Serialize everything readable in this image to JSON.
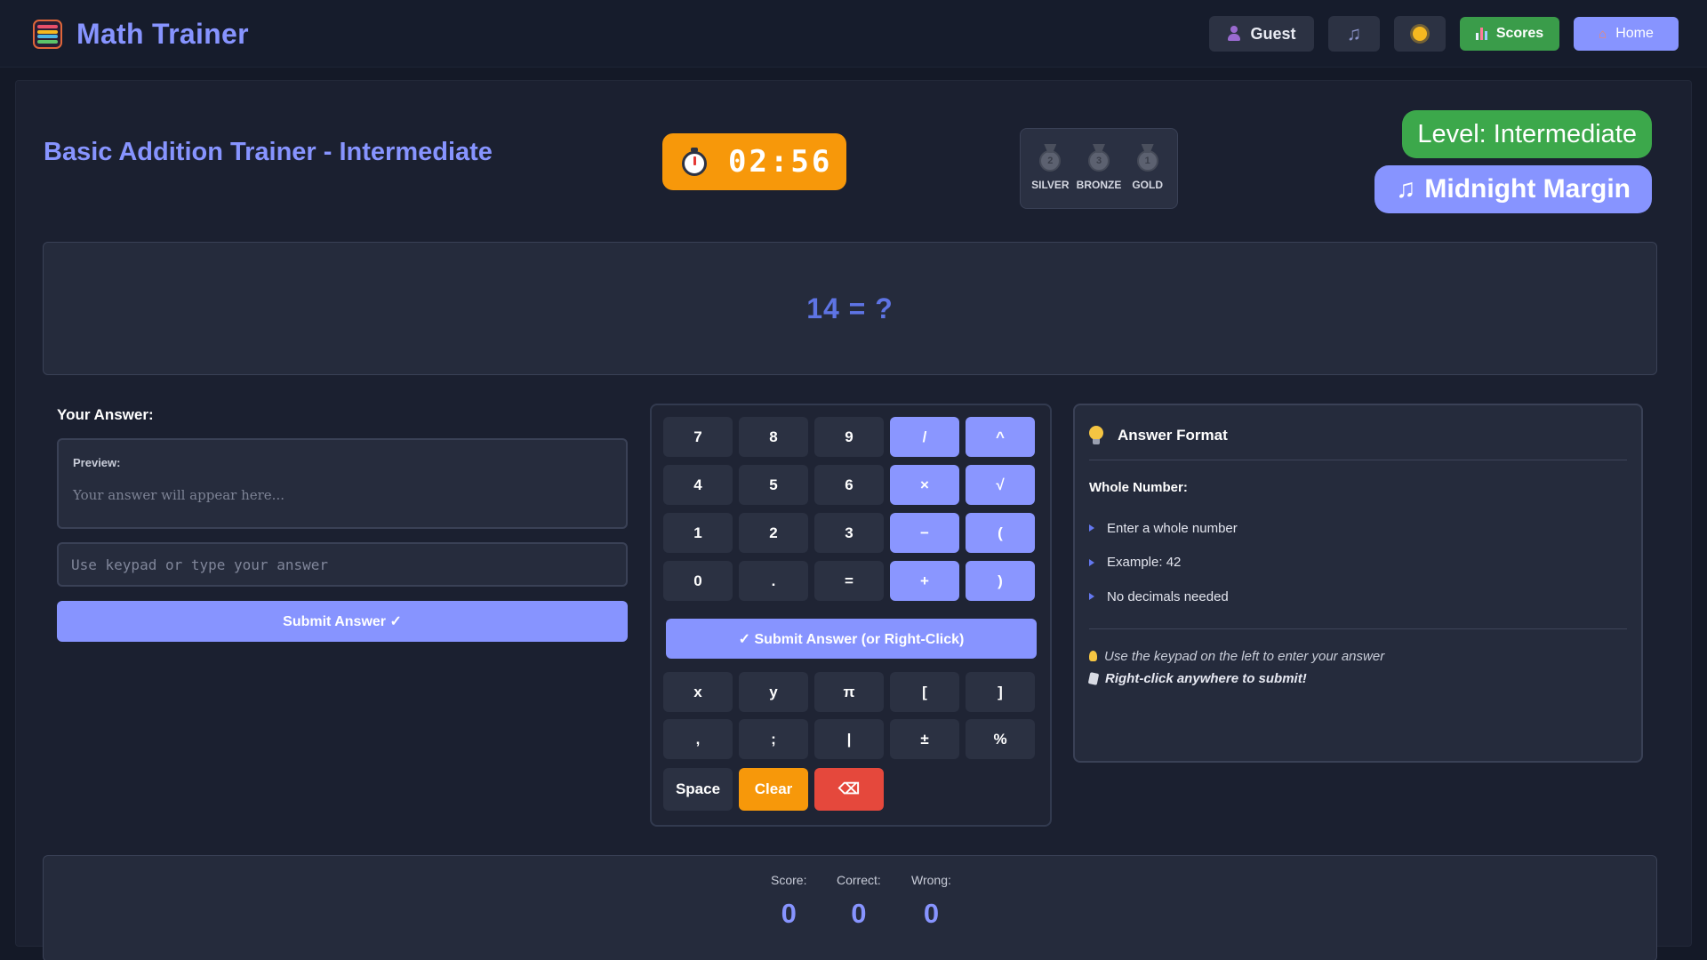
{
  "app": {
    "title": "Math Trainer"
  },
  "nav": {
    "guest_label": "Guest",
    "music_icon": "music-note-icon",
    "theme_icon": "sun-icon",
    "scores_label": "Scores",
    "home_label": "Home"
  },
  "header": {
    "title": "Basic Addition Trainer - Intermediate",
    "timer": "02:56",
    "medals": [
      {
        "label": "SILVER",
        "rank": "2"
      },
      {
        "label": "BRONZE",
        "rank": "3"
      },
      {
        "label": "GOLD",
        "rank": "1"
      }
    ],
    "level": "Level: Intermediate",
    "song": "Midnight Margin"
  },
  "question": {
    "text": "14 = ?"
  },
  "answer": {
    "label": "Your Answer:",
    "preview_label": "Preview:",
    "preview_placeholder": "Your answer will appear here...",
    "input_value": "",
    "input_placeholder": "Use keypad or type your answer",
    "submit_label": "Submit Answer ✓"
  },
  "keypad": {
    "rows_top": [
      [
        "7",
        "8",
        "9",
        "/",
        "^"
      ],
      [
        "4",
        "5",
        "6",
        "×",
        "√"
      ],
      [
        "1",
        "2",
        "3",
        "−",
        "("
      ],
      [
        "0",
        ".",
        "=",
        "+",
        ")"
      ]
    ],
    "submit_label": "✓ Submit Answer (or Right-Click)",
    "rows_bottom": [
      [
        "x",
        "y",
        "π",
        "[",
        "]"
      ],
      [
        ",",
        ";",
        "|",
        "±",
        "%"
      ]
    ],
    "space_label": "Space",
    "clear_label": "Clear",
    "backspace_label": "⌫"
  },
  "format": {
    "title": "Answer Format",
    "subtitle": "Whole Number:",
    "items": [
      "Enter a whole number",
      "Example: 42",
      "No decimals needed"
    ],
    "tip1": "Use the keypad on the left to enter your answer",
    "tip2": "Right-click anywhere to submit!"
  },
  "score": {
    "score_label": "Score:",
    "score_value": "0",
    "correct_label": "Correct:",
    "correct_value": "0",
    "wrong_label": "Wrong:",
    "wrong_value": "0"
  },
  "colors": {
    "accent": "#8794ff",
    "timer": "#f7980a",
    "level": "#3ca84b",
    "scores": "#3a9c4a",
    "clear": "#f7980a",
    "backspace": "#e5483c",
    "background": "#141927"
  }
}
